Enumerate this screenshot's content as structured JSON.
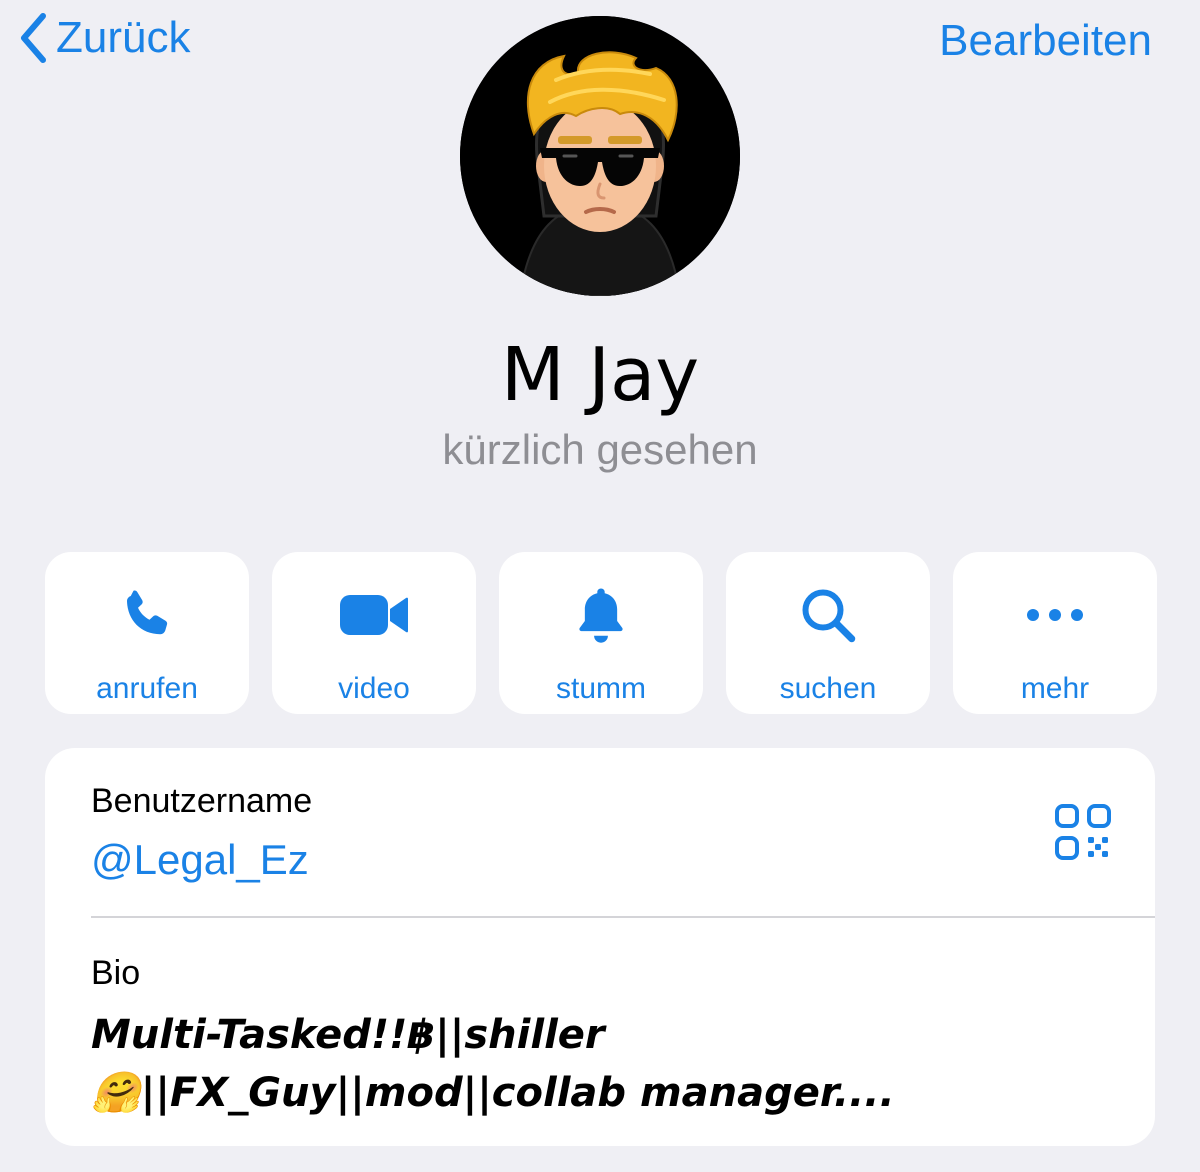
{
  "nav": {
    "back_label": "Zurück",
    "edit_label": "Bearbeiten"
  },
  "profile": {
    "name": "M Jay",
    "status": "kürzlich gesehen",
    "avatar_icon": "cartoon-avatar-sunglasses"
  },
  "actions": [
    {
      "label": "anrufen",
      "icon": "phone-icon"
    },
    {
      "label": "video",
      "icon": "video-camera-icon"
    },
    {
      "label": "stumm",
      "icon": "bell-icon"
    },
    {
      "label": "suchen",
      "icon": "search-icon"
    },
    {
      "label": "mehr",
      "icon": "more-icon"
    }
  ],
  "info": {
    "username_label": "Benutzername",
    "username": "@Legal_Ez",
    "bio_label": "Bio",
    "bio": "Multi-Tasked!!฿||shiller 🤗||FX_Guy||mod||collab manager...."
  },
  "colors": {
    "accent": "#1a82e6",
    "background": "#efeff4",
    "card": "#ffffff",
    "secondary_text": "#8e8e93"
  }
}
